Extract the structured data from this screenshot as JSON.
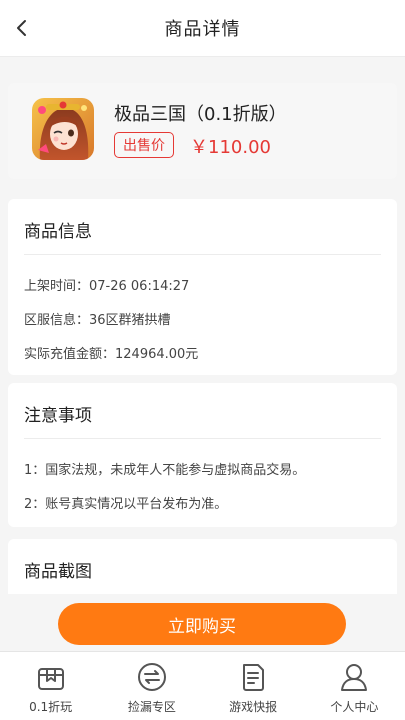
{
  "header": {
    "title": "商品详情",
    "back_icon": "chevron-left-icon"
  },
  "game": {
    "name": "极品三国（0.1折版）",
    "badge": "出售价",
    "price": "￥110.00",
    "icon": "game-avatar-icon"
  },
  "info": {
    "title": "商品信息",
    "rows": [
      "上架时间：07-26 06:14:27",
      "区服信息：36区群猪拱槽",
      "实际充值金额：124964.00元"
    ]
  },
  "notice": {
    "title": "注意事项",
    "rows": [
      "1：国家法规，未成年人不能参与虚拟商品交易。",
      "2：账号真实情况以平台发布为准。"
    ]
  },
  "screenshots": {
    "title": "商品截图"
  },
  "buy_button": "立即购买",
  "tabbar": {
    "items": [
      {
        "label": "0.1折玩",
        "icon": "gift-box-icon"
      },
      {
        "label": "捡漏专区",
        "icon": "swap-arrows-icon"
      },
      {
        "label": "游戏快报",
        "icon": "news-document-icon"
      },
      {
        "label": "个人中心",
        "icon": "user-icon"
      }
    ]
  },
  "colors": {
    "accent": "#ff7a12",
    "price": "#e53935"
  }
}
